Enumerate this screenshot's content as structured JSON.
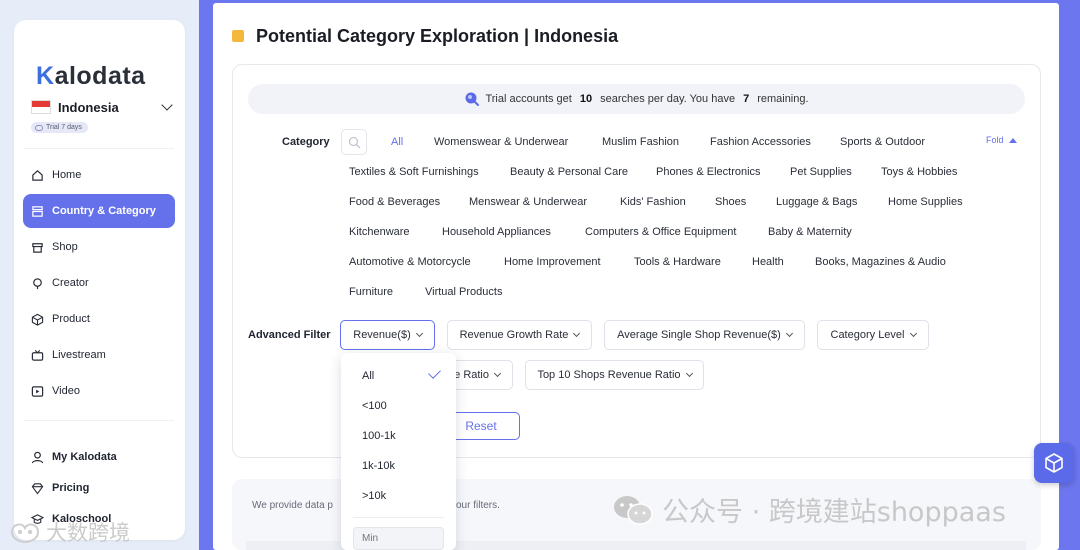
{
  "sidebar": {
    "logo": {
      "initial": "K",
      "rest": "alodata"
    },
    "country": "Indonesia",
    "trial_badge": "Trial  7 days",
    "nav": [
      {
        "label": "Home",
        "icon": "home-icon"
      },
      {
        "label": "Country & Category",
        "icon": "category-icon",
        "active": true
      },
      {
        "label": "Shop",
        "icon": "shop-icon"
      },
      {
        "label": "Creator",
        "icon": "creator-icon"
      },
      {
        "label": "Product",
        "icon": "product-icon"
      },
      {
        "label": "Livestream",
        "icon": "livestream-icon"
      },
      {
        "label": "Video",
        "icon": "video-icon"
      }
    ],
    "bottom_nav": [
      {
        "label": "My Kalodata",
        "icon": "user-icon"
      },
      {
        "label": "Pricing",
        "icon": "diamond-icon"
      },
      {
        "label": "Kaloschool",
        "icon": "school-icon"
      }
    ]
  },
  "header": {
    "title": "Potential Category Exploration | Indonesia"
  },
  "notice": {
    "prefix": "Trial accounts get",
    "searches": "10",
    "middle": "searches per day. You have",
    "remaining": "7",
    "suffix": "remaining."
  },
  "category_filter": {
    "label": "Category",
    "fold": "Fold",
    "rows": [
      [
        "All",
        "Womenswear & Underwear",
        "Muslim Fashion",
        "Fashion Accessories",
        "Sports & Outdoor"
      ],
      [
        "Textiles & Soft Furnishings",
        "Beauty & Personal Care",
        "Phones & Electronics",
        "Pet Supplies",
        "Toys & Hobbies"
      ],
      [
        "Food & Beverages",
        "Menswear & Underwear",
        "Kids' Fashion",
        "Shoes",
        "Luggage & Bags",
        "Home Supplies"
      ],
      [
        "Kitchenware",
        "Household Appliances",
        "Computers & Office Equipment",
        "Baby & Maternity"
      ],
      [
        "Automotive & Motorcycle",
        "Home Improvement",
        "Tools & Hardware",
        "Health",
        "Books, Magazines & Audio"
      ],
      [
        "Furniture",
        "Virtual Products"
      ]
    ]
  },
  "advanced_filter": {
    "label": "Advanced Filter",
    "buttons": [
      "Revenue($)",
      "Revenue Growth Rate",
      "Average Single Shop Revenue($)",
      "Category Level",
      "e Ratio",
      "Top 10 Shops Revenue Ratio"
    ],
    "reset": "Reset"
  },
  "revenue_dropdown": {
    "options": [
      "All",
      "<100",
      "100-1k",
      "1k-10k",
      ">10k"
    ],
    "selected": "All",
    "min_placeholder": "Min"
  },
  "footer_text": {
    "part1": "We provide data p",
    "part2": "our filters."
  },
  "watermarks": {
    "right": "公众号 · 跨境建站shoppaas",
    "left": "大数跨境"
  },
  "colors": {
    "accent": "#6471ea",
    "title_mark": "#f4b83c",
    "frame": "#6c76ee"
  }
}
